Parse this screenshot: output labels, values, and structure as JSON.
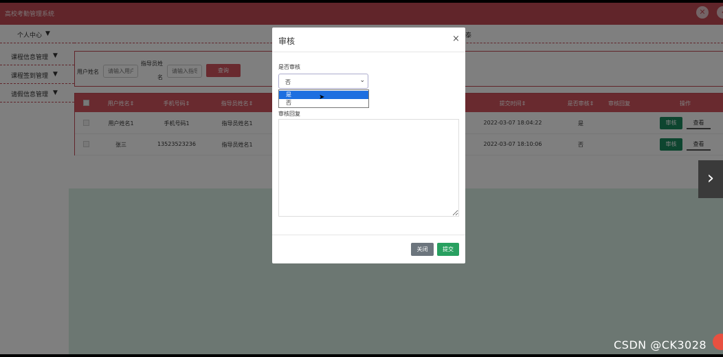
{
  "app": {
    "title": "高校考勤管理系统"
  },
  "sidebar": {
    "items": [
      {
        "label": "个人中心"
      },
      {
        "label": "课程信息管理"
      },
      {
        "label": "课程签到管理"
      },
      {
        "label": "请假信息管理"
      }
    ]
  },
  "navrow": {
    "tail_text": "泰"
  },
  "search": {
    "field1_label": "用户姓名",
    "field1_placeholder": "请输入用户",
    "field2_label_line1": "指导员姓",
    "field2_label_line2": "名",
    "field2_placeholder": "请输入指导",
    "query_button": "查询"
  },
  "table": {
    "headers": [
      "用户姓名",
      "手机号码",
      "指导员姓名",
      "提交时间",
      "是否审核",
      "审核回复",
      "操作"
    ],
    "rows": [
      {
        "name": "用户姓名1",
        "phone": "手机号码1",
        "instructor": "指导员姓名1",
        "time": "2022-03-07 18:04:22",
        "audited": "是",
        "reply": ""
      },
      {
        "name": "张三",
        "phone": "13523523236",
        "instructor": "指导员姓名1",
        "time": "2022-03-07 18:10:06",
        "audited": "否",
        "reply": ""
      }
    ],
    "audit_button": "审核",
    "view_button": "查看"
  },
  "modal": {
    "title": "审核",
    "close_symbol": "×",
    "audit_field_label": "是否审核",
    "select_value": "否",
    "options": [
      "是",
      "否"
    ],
    "highlighted_option": "是",
    "reply_label": "审核回复",
    "close_button": "关闭",
    "submit_button": "提交"
  },
  "nav": {
    "next_symbol": "›"
  },
  "watermark": "CSDN @CK3028",
  "colors": {
    "brand": "#c24a55",
    "header_red": "#d2545e",
    "green": "#1a8a5e",
    "submit_green": "#28a060",
    "close_gray": "#6c757d"
  }
}
